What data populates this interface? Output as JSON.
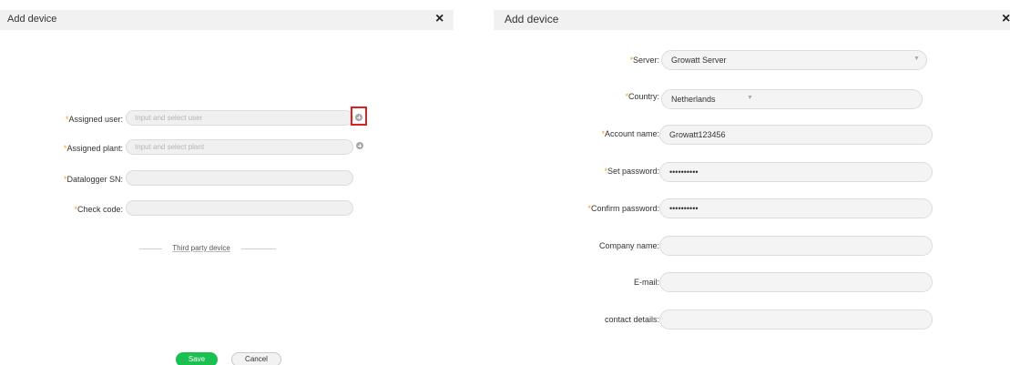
{
  "left_dialog": {
    "title": "Add device",
    "close_symbol": "×",
    "fields": [
      {
        "label": "Assigned user:",
        "required": "*",
        "placeholder": "Input and select user"
      },
      {
        "label": "Assigned plant:",
        "required": "*",
        "placeholder": "Input and select plant"
      },
      {
        "label": "Datalogger SN:",
        "required": "*",
        "placeholder": ""
      },
      {
        "label": "Check code:",
        "required": "*",
        "placeholder": ""
      }
    ],
    "third_party_link": "Third party device",
    "save_label": "Save",
    "cancel_label": "Cancel"
  },
  "right_dialog": {
    "title": "Add device",
    "close_symbol": "×",
    "fields": [
      {
        "label": "Server:",
        "required": "*",
        "value": "Growatt Server"
      },
      {
        "label": "Country:",
        "required": "*",
        "value": "Netherlands"
      },
      {
        "label": "Account name:",
        "required": "*",
        "value": "Growatt123456"
      },
      {
        "label": "Set password:",
        "required": "*",
        "value": "••••••••••"
      },
      {
        "label": "Confirm password:",
        "required": "*",
        "value": "••••••••••"
      },
      {
        "label": "Company name:",
        "required": "",
        "value": ""
      },
      {
        "label": "E-mail:",
        "required": "",
        "value": ""
      },
      {
        "label": "contact details:",
        "required": "",
        "value": ""
      }
    ]
  },
  "icons": {
    "close": "close-icon",
    "add": "plus-circle-icon",
    "dropdown": "caret-down-icon"
  },
  "colors": {
    "required_marker": "#f0a500",
    "save_button": "#1ac050",
    "highlight_box": "#e02020"
  }
}
